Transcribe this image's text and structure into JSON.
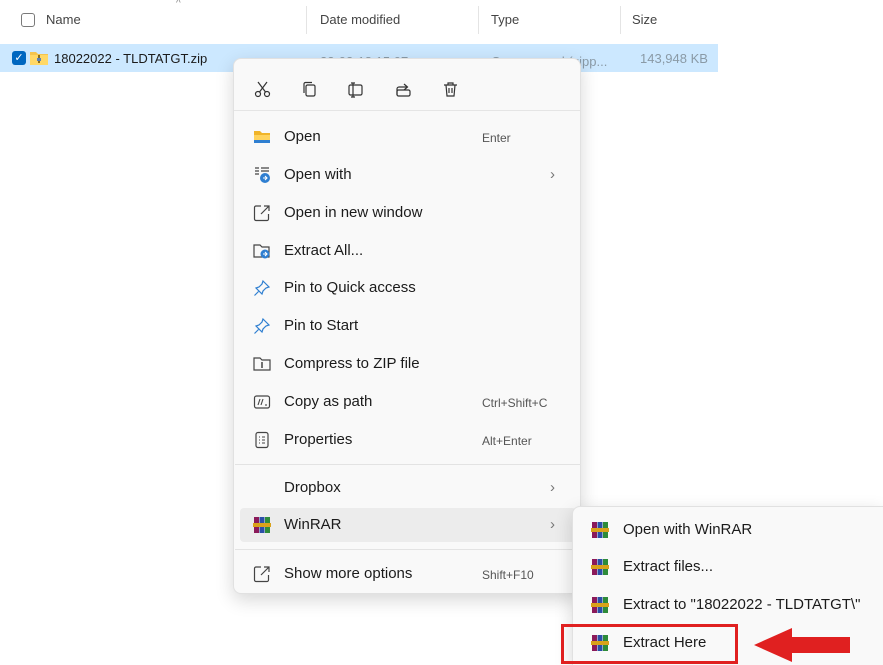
{
  "header": {
    "name": "Name",
    "date_modified": "Date modified",
    "type": "Type",
    "size": "Size"
  },
  "file": {
    "name": "18022022 - TLDTATGT.zip",
    "date": "22-02-18 15:07",
    "type": "Compressed (zipp...",
    "size": "143,948 KB"
  },
  "toolbar": {
    "icons": [
      "cut-icon",
      "copy-icon",
      "rename-icon",
      "share-icon",
      "delete-icon"
    ]
  },
  "menu": {
    "items": [
      {
        "label": "Open",
        "shortcut": "Enter",
        "icon": "folder-icon"
      },
      {
        "label": "Open with",
        "shortcut": "",
        "icon": "open-with-icon",
        "submenu": true
      },
      {
        "label": "Open in new window",
        "shortcut": "",
        "icon": "new-window-icon"
      },
      {
        "label": "Extract All...",
        "shortcut": "",
        "icon": "extract-all-icon"
      },
      {
        "label": "Pin to Quick access",
        "shortcut": "",
        "icon": "pin-icon"
      },
      {
        "label": "Pin to Start",
        "shortcut": "",
        "icon": "pin-icon"
      },
      {
        "label": "Compress to ZIP file",
        "shortcut": "",
        "icon": "zip-icon"
      },
      {
        "label": "Copy as path",
        "shortcut": "Ctrl+Shift+C",
        "icon": "path-icon"
      },
      {
        "label": "Properties",
        "shortcut": "Alt+Enter",
        "icon": "properties-icon"
      },
      {
        "label": "Dropbox",
        "shortcut": "",
        "icon": "",
        "submenu": true
      },
      {
        "label": "WinRAR",
        "shortcut": "",
        "icon": "winrar-icon",
        "submenu": true
      },
      {
        "label": "Show more options",
        "shortcut": "Shift+F10",
        "icon": "more-options-icon"
      }
    ]
  },
  "submenu": {
    "items": [
      {
        "label": "Open with WinRAR"
      },
      {
        "label": "Extract files..."
      },
      {
        "label": "Extract to \"18022022 - TLDTATGT\\\""
      },
      {
        "label": "Extract Here"
      }
    ]
  },
  "colors": {
    "selection": "#cce8ff",
    "accent": "#0067c0",
    "annotation": "#e02020"
  }
}
